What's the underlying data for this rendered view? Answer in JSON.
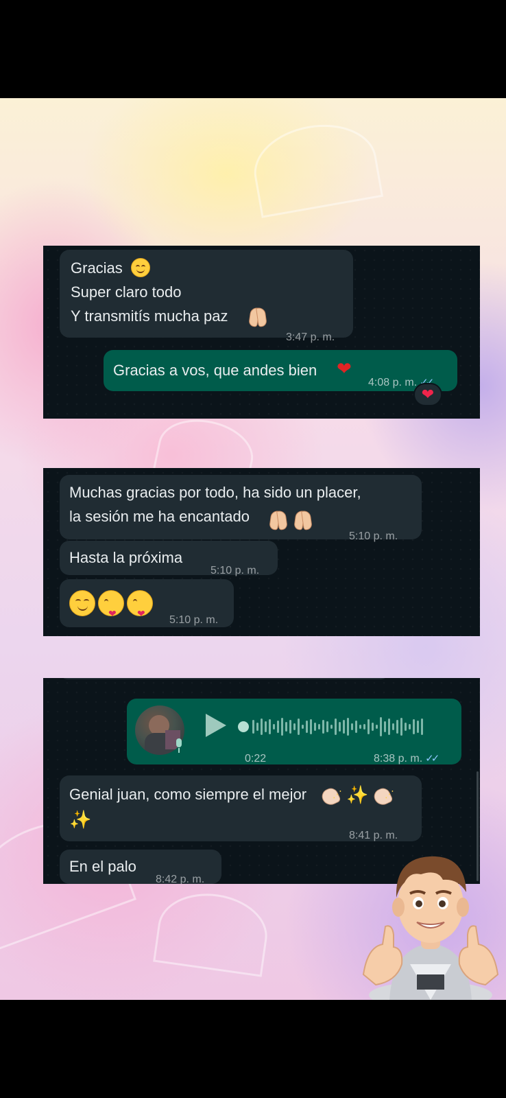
{
  "panel1": {
    "incoming": {
      "text": "Gracias\nSuper claro todo\nY transmitís mucha paz",
      "time": "3:47 p. m.",
      "emojis": [
        "smiling-face-icon",
        "praying-hands-icon"
      ]
    },
    "outgoing": {
      "text": "Gracias a vos, que andes bien",
      "time": "4:08 p. m.",
      "ticks": "✓✓",
      "emoji": "red-heart-icon",
      "reaction": "❤"
    }
  },
  "panel2": {
    "message1": {
      "text": "Muchas gracias por todo, ha sido un placer,\nla sesión me ha encantado",
      "time": "5:10 p. m.",
      "emojis": [
        "praying-hands-icon",
        "praying-hands-icon"
      ]
    },
    "message2": {
      "text": "Hasta la próxima",
      "time": "5:10 p. m."
    },
    "message3": {
      "time": "5:10 p. m.",
      "emojis": [
        "smiling-face-icon",
        "face-blowing-kiss-icon",
        "face-blowing-kiss-icon"
      ]
    }
  },
  "panel3": {
    "voice_note": {
      "duration": "0:22",
      "time": "8:38 p. m.",
      "ticks": "✓✓",
      "played_fraction": 0.0
    },
    "message1": {
      "text": "Genial juan, como siempre el mejor",
      "time": "8:41 p. m.",
      "emojis": [
        "clapping-hands-icon",
        "sparkles-icon",
        "clapping-hands-icon",
        "sparkles-icon"
      ]
    },
    "message2": {
      "text": "En el palo",
      "time": "8:42 p. m."
    }
  },
  "colors": {
    "chat_bg": "#0b141a",
    "incoming_bubble": "#202c33",
    "outgoing_bubble": "#005c4b",
    "text": "#e9edef",
    "read_ticks": "#8fc8ff"
  }
}
